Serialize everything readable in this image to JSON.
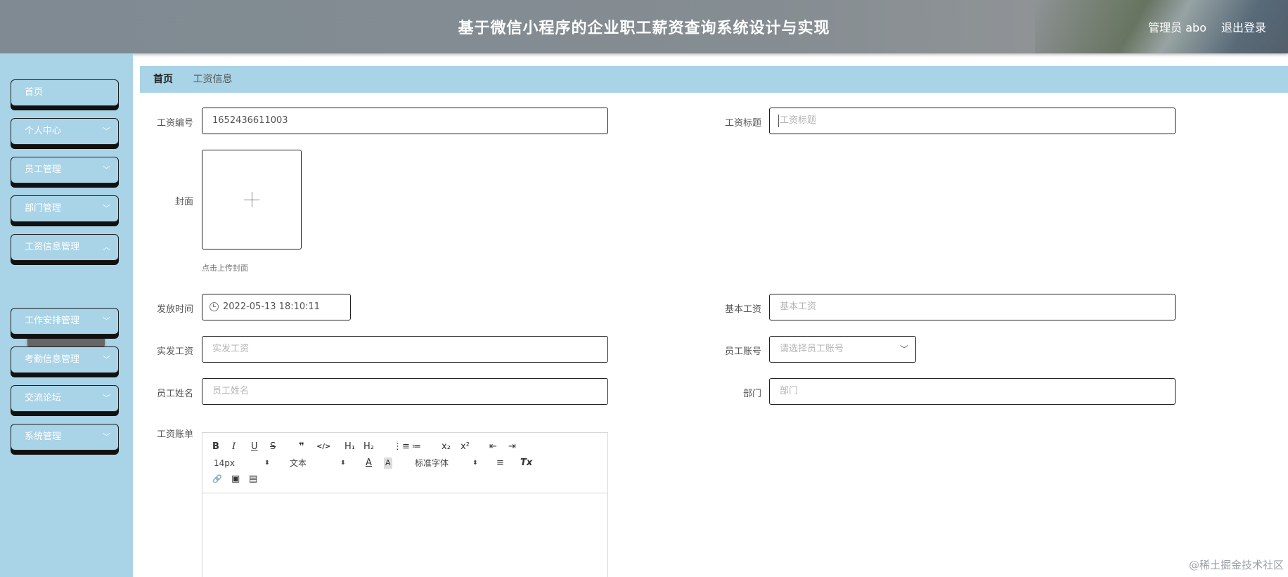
{
  "header": {
    "title": "基于微信小程序的企业职工薪资查询系统设计与实现",
    "user": "管理员 abo",
    "logout": "退出登录"
  },
  "sidebar": {
    "items": [
      {
        "label": "首页"
      },
      {
        "label": "个人中心"
      },
      {
        "label": "员工管理"
      },
      {
        "label": "部门管理"
      },
      {
        "label": "工资信息管理"
      },
      {
        "label": "工作安排管理"
      },
      {
        "label": "考勤信息管理"
      },
      {
        "label": "交流论坛"
      },
      {
        "label": "系统管理"
      }
    ],
    "active_sub": "工资信息"
  },
  "breadcrumb": {
    "home": "首页",
    "current": "工资信息"
  },
  "form": {
    "salary_no": {
      "label": "工资编号",
      "value": "1652436611003"
    },
    "salary_title": {
      "label": "工资标题",
      "placeholder": "工资标题"
    },
    "cover": {
      "label": "封面",
      "tip": "点击上传封面"
    },
    "issue_time": {
      "label": "发放时间",
      "value": "2022-05-13 18:10:11"
    },
    "base_salary": {
      "label": "基本工资",
      "placeholder": "基本工资"
    },
    "actual_salary": {
      "label": "实发工资",
      "placeholder": "实发工资"
    },
    "employee_account": {
      "label": "员工账号",
      "placeholder": "请选择员工账号"
    },
    "employee_name": {
      "label": "员工姓名",
      "placeholder": "员工姓名"
    },
    "department": {
      "label": "部门",
      "placeholder": "部门"
    },
    "salary_bill": {
      "label": "工资账单"
    }
  },
  "editor": {
    "font_size": "14px",
    "heading": "文本",
    "font_family": "标准字体",
    "buttons": {
      "bold": "B",
      "italic": "I",
      "underline": "U",
      "strike": "S",
      "quote": "❞",
      "code": "</>",
      "h1": "H₁",
      "h2": "H₂",
      "ordered": "⋮≡",
      "bullet": "≔",
      "sub": "x₂",
      "sup": "x²",
      "outdent": "⇤",
      "indent": "⇥",
      "color": "A",
      "background": "A",
      "align": "≡",
      "clean": "Tx",
      "link": "🔗",
      "image": "▣",
      "video": "▤"
    }
  },
  "watermark": "@稀土掘金技术社区"
}
